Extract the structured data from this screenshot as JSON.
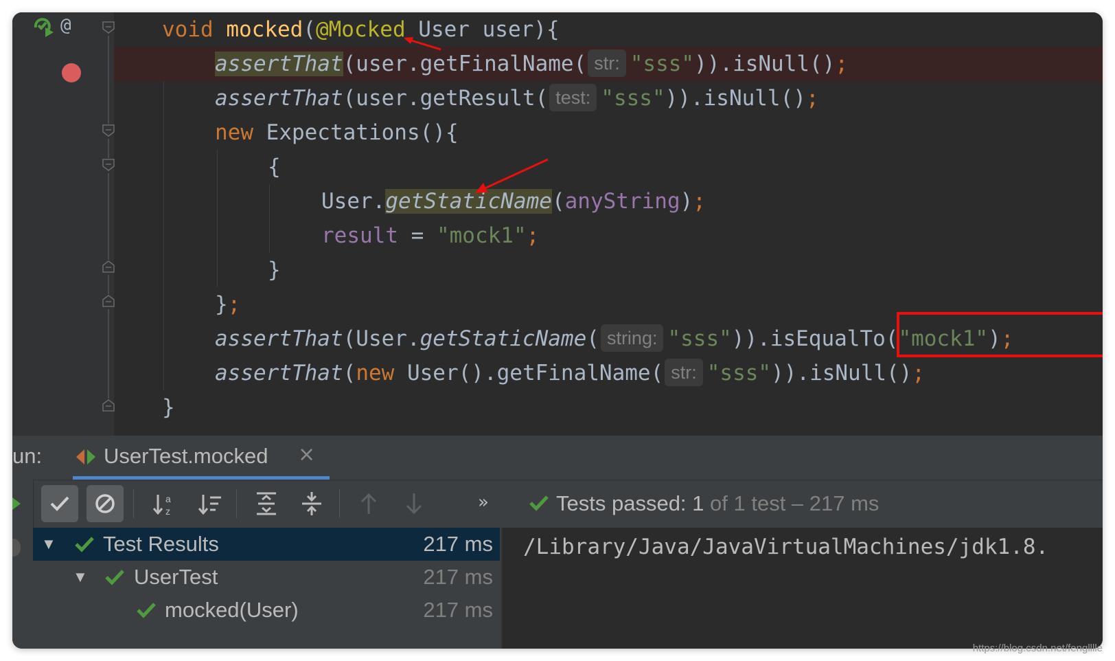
{
  "code": {
    "l1": {
      "kw": "void ",
      "fn": "mocked",
      "p1": "(",
      "anno": "@Mocked",
      "rest": " User user){"
    },
    "l2": {
      "call": "assertThat",
      "p1": "(user.getFinalName(",
      "hint": "str:",
      "str": "\"sss\"",
      "p2": ")).isNull()",
      "semi": ";"
    },
    "l3": {
      "call": "assertThat",
      "p1": "(user.getResult(",
      "hint": "test:",
      "str": "\"sss\"",
      "p2": ")).isNull()",
      "semi": ";"
    },
    "l4": {
      "kw": "new ",
      "rest": "Expectations(){"
    },
    "l5": {
      "text": "{"
    },
    "l6": {
      "p1": "User.",
      "method": "getStaticName",
      "p2": "(",
      "field": "anyString",
      "p3": ")",
      "semi": ";"
    },
    "l7": {
      "field": "result",
      "p1": " = ",
      "str": "\"mock1\"",
      "semi": ";"
    },
    "l8": {
      "text": "}"
    },
    "l9": {
      "text": "}",
      "semi": ";"
    },
    "l10": {
      "call": "assertThat",
      "p1": "(User.",
      "method": "getStaticName",
      "p2": "(",
      "hint": "string:",
      "str": "\"sss\"",
      "p3": ")).isEqualTo(",
      "str2": "\"mock1\"",
      "p4": ")",
      "semi": ";"
    },
    "l11": {
      "call": "assertThat",
      "p1": "(",
      "kw": "new ",
      "p2": "User().getFinalName(",
      "hint": "str:",
      "str": "\"sss\"",
      "p3": ")).isNull()",
      "semi": ";"
    },
    "l12": {
      "text": "}"
    }
  },
  "run": {
    "label": "un:",
    "tab_label": "UserTest.mocked",
    "close_glyph": "×",
    "more_glyph": "»",
    "status": {
      "label": "Tests passed: ",
      "count": "1",
      "rest": " of 1 test – 217 ms"
    },
    "tree": [
      {
        "name": "Test Results",
        "time": "217 ms"
      },
      {
        "name": "UserTest",
        "time": "217 ms"
      },
      {
        "name": "mocked(User)",
        "time": "217 ms"
      }
    ],
    "console_text": "/Library/Java/JavaVirtualMachines/jdk1.8."
  },
  "watermark": "https://blog.csdn.net/fenglllle",
  "colors": {
    "editor_bg": "#2b2b2b",
    "keyword": "#cc7832",
    "function": "#ffc66d",
    "annotation": "#bbb529",
    "string": "#6a8759",
    "field": "#9876aa",
    "pass_green": "#4e9a3e",
    "highlight_box": "#e8100e",
    "breakpoint": "#db5c5c"
  },
  "icons": [
    "run-test-icon",
    "override-icon",
    "breakpoint-icon",
    "fold-marker-icon",
    "show-passed-icon",
    "show-ignored-icon",
    "sort-alpha-icon",
    "sort-duration-icon",
    "expand-all-icon",
    "collapse-all-icon",
    "prev-failed-icon",
    "next-failed-icon",
    "check-icon",
    "close-icon"
  ]
}
